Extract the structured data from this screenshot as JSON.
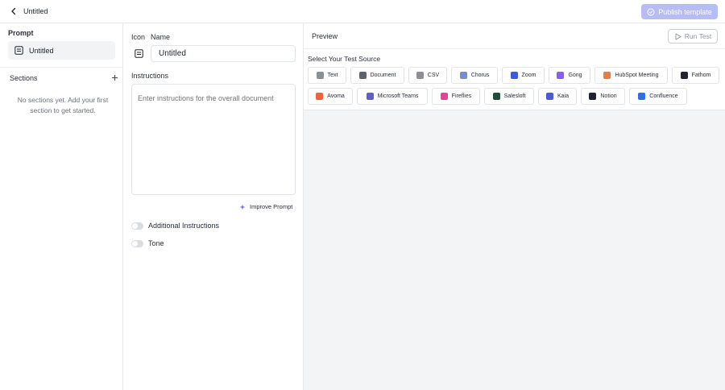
{
  "header": {
    "title": "Untitled",
    "publish_label": "Publish template"
  },
  "left": {
    "prompt_heading": "Prompt",
    "prompt_item_label": "Untitled",
    "sections_heading": "Sections",
    "empty_message": "No sections yet. Add your first section to get started."
  },
  "editor": {
    "icon_label": "Icon",
    "name_label": "Name",
    "name_value": "Untitled",
    "instructions_label": "Instructions",
    "instructions_placeholder": "Enter instructions for the overall document",
    "improve_label": "Improve Prompt",
    "toggles": [
      {
        "label": "Additional Instructions",
        "on": false
      },
      {
        "label": "Tone",
        "on": false
      }
    ]
  },
  "preview": {
    "heading": "Preview",
    "run_label": "Run Test",
    "source_heading": "Select Your Test Source",
    "sources_row1": [
      {
        "label": "Text",
        "icon": "lines-icon",
        "color": "#8a8f99"
      },
      {
        "label": "Document",
        "icon": "document-icon",
        "color": "#5c6270"
      },
      {
        "label": "CSV",
        "icon": "file-icon",
        "color": "#8a8f99"
      },
      {
        "label": "Chorus",
        "icon": "chorus-icon",
        "color": "#6f8fd8"
      },
      {
        "label": "Zoom",
        "icon": "zoom-icon",
        "color": "#3b5bdb"
      },
      {
        "label": "Gong",
        "icon": "gong-icon",
        "color": "#8b5cf6"
      },
      {
        "label": "HubSpot Meeting",
        "icon": "hubspot-icon",
        "color": "#f07a3a"
      },
      {
        "label": "Fathom",
        "icon": "fathom-icon",
        "color": "#1f2430"
      }
    ],
    "sources_row2": [
      {
        "label": "Avoma",
        "icon": "avoma-icon",
        "color": "#f0623a"
      },
      {
        "label": "Microsoft Teams",
        "icon": "teams-icon",
        "color": "#5b5fc7"
      },
      {
        "label": "Fireflies",
        "icon": "fireflies-icon",
        "color": "#e84393"
      },
      {
        "label": "Salesloft",
        "icon": "salesloft-icon",
        "color": "#1f4d3a"
      },
      {
        "label": "Kaia",
        "icon": "kaia-icon",
        "color": "#4b5bd6"
      },
      {
        "label": "Notion",
        "icon": "notion-icon",
        "color": "#1f2430"
      },
      {
        "label": "Confluence",
        "icon": "confluence-icon",
        "color": "#2f6fe0"
      }
    ]
  },
  "colors": {
    "accent": "#b6bdf5",
    "border": "#e1e4e8",
    "preview_bg": "#f3f4f6"
  }
}
